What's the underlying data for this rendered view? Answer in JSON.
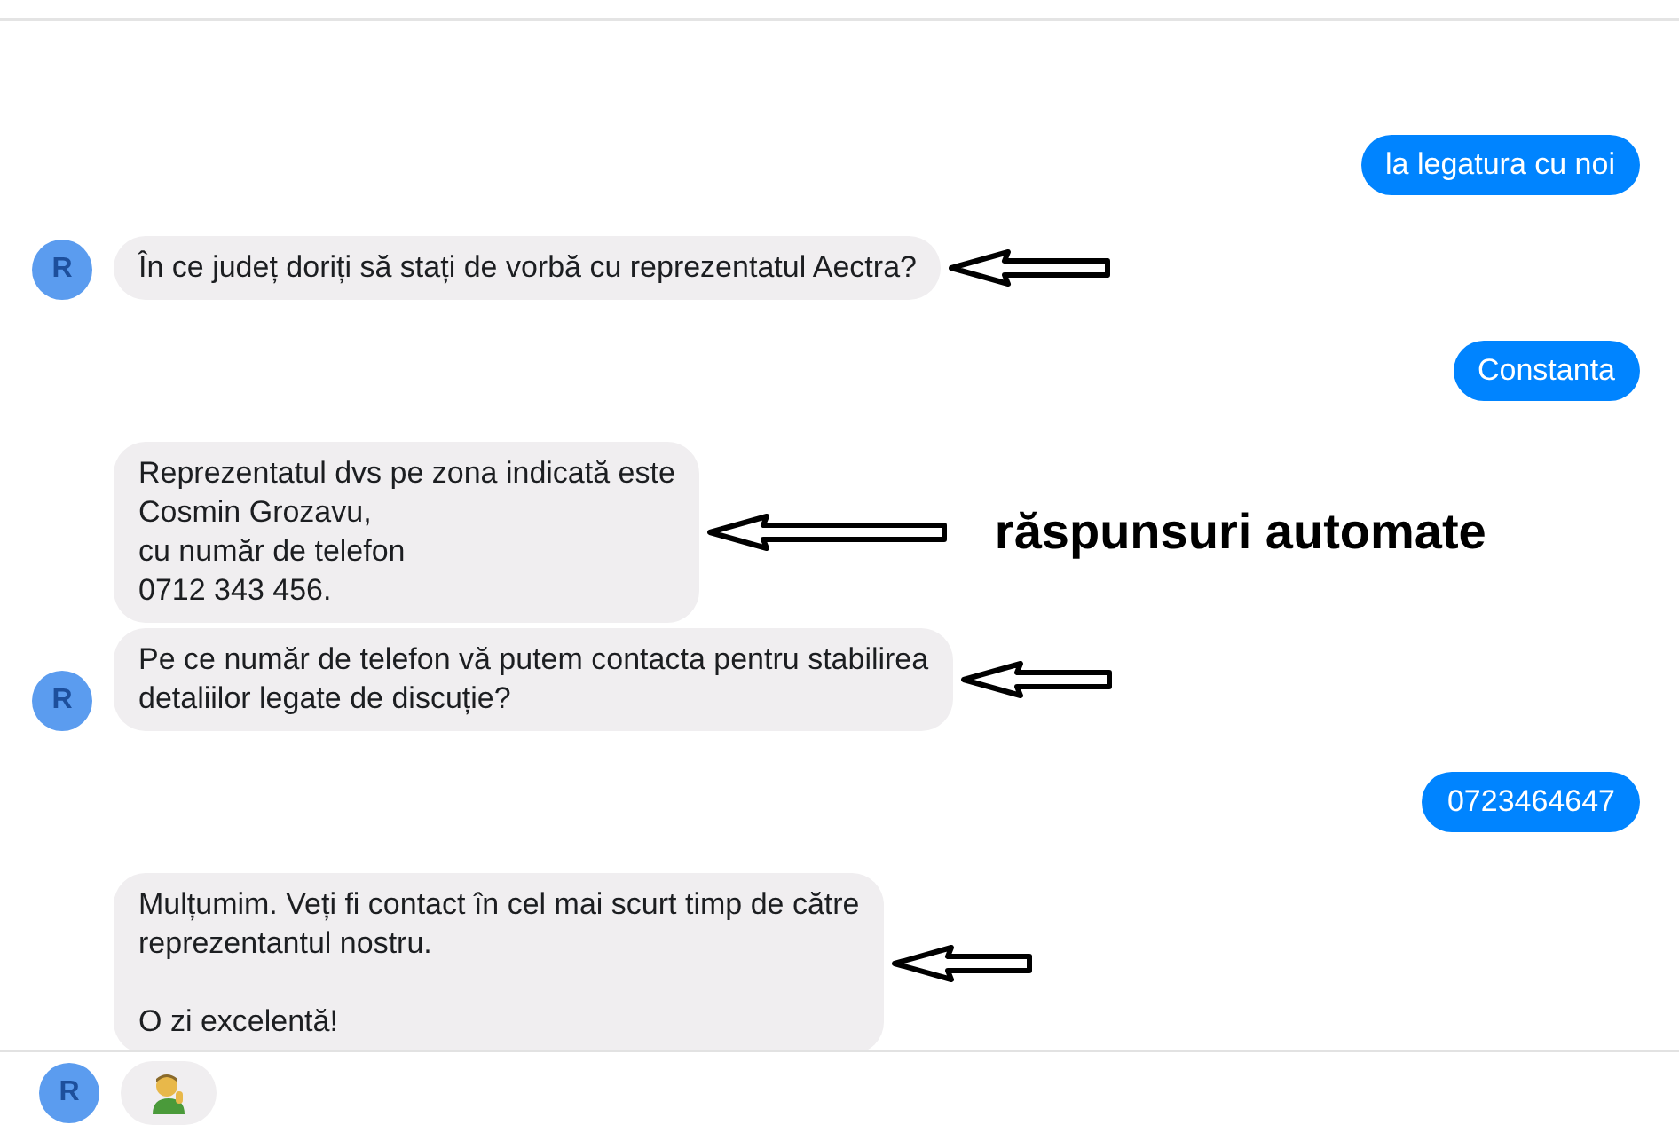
{
  "messages": [
    {
      "kind": "sent",
      "text": "la legatura cu noi",
      "arrow": false
    },
    {
      "kind": "received",
      "text": "În ce județ doriți să stați de vorbă cu reprezentatul Aectra?",
      "avatar": true,
      "avatar_letter": "R",
      "arrow": true
    },
    {
      "kind": "sent",
      "text": "Constanta",
      "arrow": false
    },
    {
      "kind": "received",
      "text": "Reprezentatul dvs pe zona indicată este\nCosmin Grozavu,\ncu număr de telefon\n0712 343 456.",
      "avatar": false,
      "arrow": true,
      "note": "răspunsuri automate"
    },
    {
      "kind": "received",
      "text": "Pe ce număr de telefon vă putem contacta pentru stabilirea\ndetaliilor legate de discuție?",
      "avatar": true,
      "avatar_letter": "R",
      "arrow": true
    },
    {
      "kind": "sent",
      "text": "0723464647",
      "arrow": false
    },
    {
      "kind": "received",
      "text": "Mulțumim. Veți fi contact în cel mai scurt timp de către\nreprezentantul nostru.\n\nO zi excelentă!",
      "avatar": false,
      "arrow": true
    }
  ],
  "footer": {
    "avatar_letter": "R",
    "kind": "emoji"
  }
}
